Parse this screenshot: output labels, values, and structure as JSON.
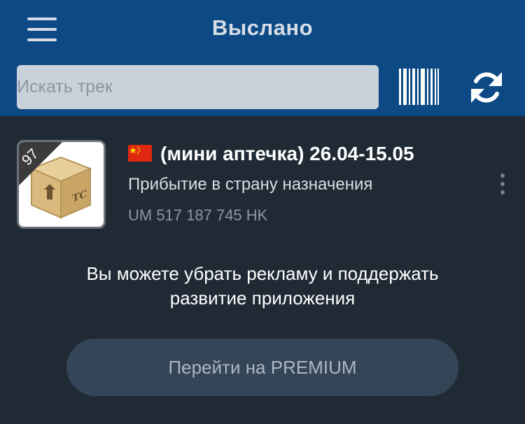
{
  "header": {
    "title": "Выслано",
    "search_placeholder": "Искать трек",
    "icons": [
      "menu-icon",
      "barcode-icon",
      "refresh-icon"
    ]
  },
  "parcel": {
    "days": "97",
    "flag": "china-flag-icon",
    "title": "(мини аптечка) 26.04-15.05",
    "status": "Прибытие в страну назначения",
    "track": "UM 517 187 745 HK"
  },
  "promo": {
    "line1": "Вы можете убрать рекламу и поддержать",
    "line2": "развитие приложения"
  },
  "premium_button": {
    "label": "Перейти на PREMIUM"
  },
  "colors": {
    "header_bg": "#0d4a85",
    "page_bg": "#1f2a35",
    "search_bg": "#c9d1da",
    "button_bg": "#344558",
    "flag_red": "#de2910",
    "flag_yellow": "#ffde00"
  }
}
